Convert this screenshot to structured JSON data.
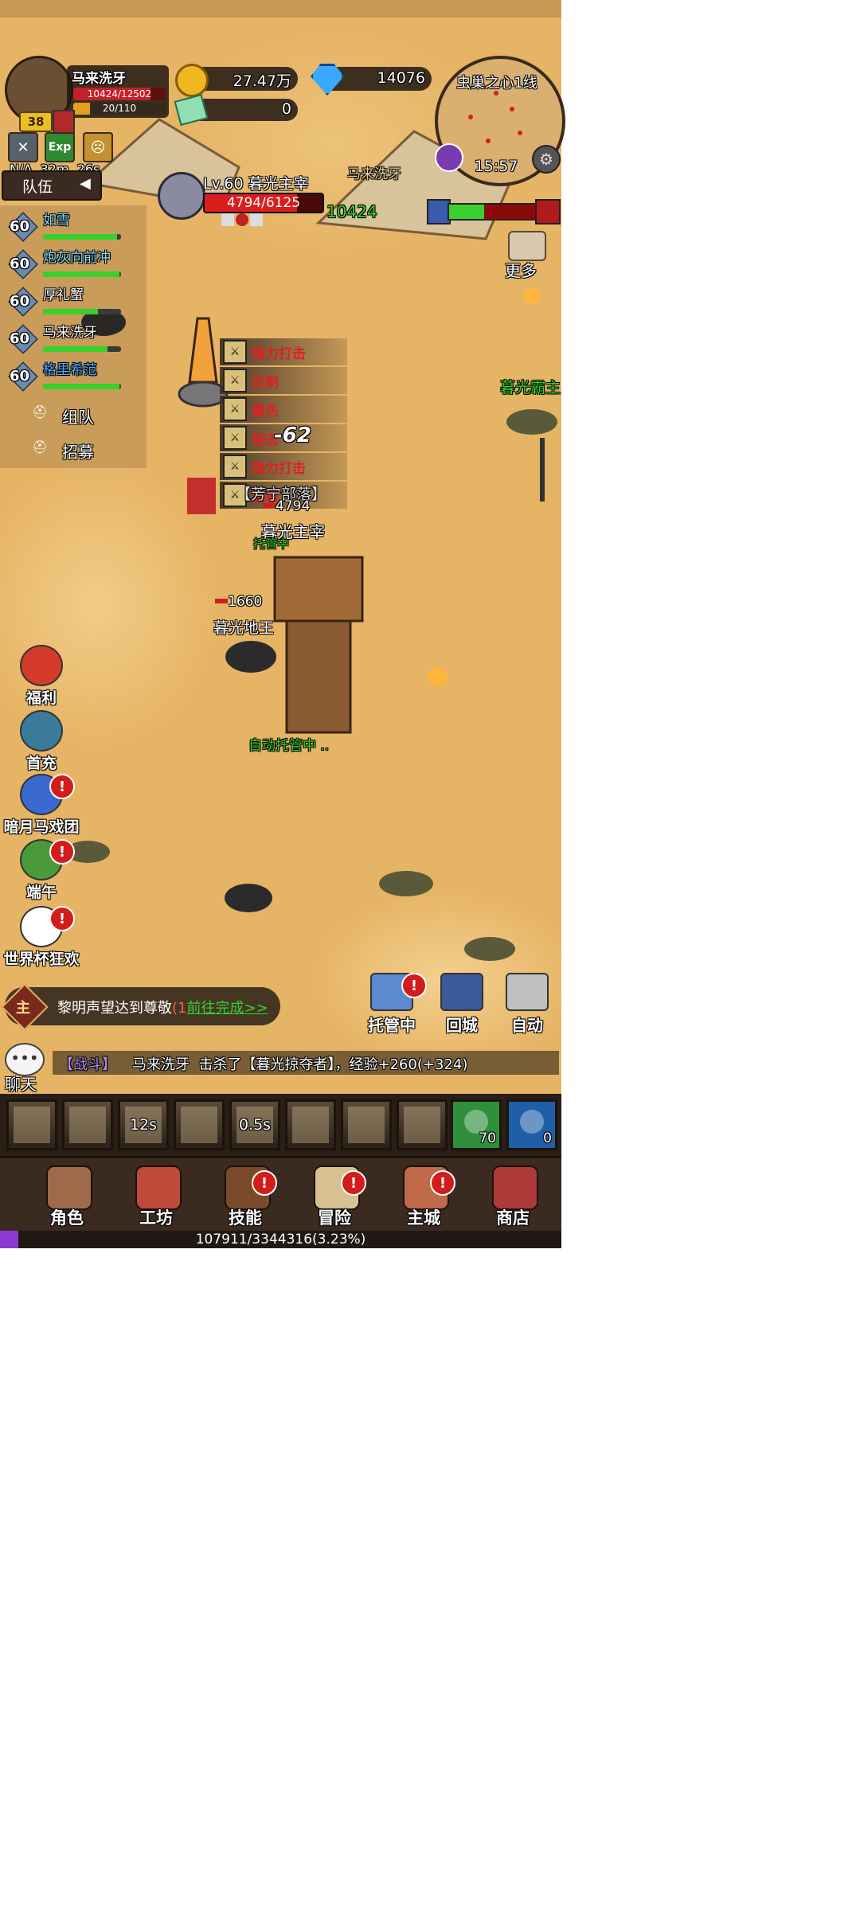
{
  "player": {
    "name": "马来洗牙",
    "hp_text": "10424/12502",
    "mp_text": "20/110",
    "level": "38",
    "buff_text": "N/A  32m  26s",
    "team_label": "队伍",
    "hp_ratio": 0.834,
    "mp_ratio": 0.18
  },
  "currency": {
    "gold": "27.47万",
    "gem": "14076",
    "ticket": "0"
  },
  "minimap": {
    "title": "虫巢之心1线",
    "time": "15:57"
  },
  "target": {
    "title": "Lv.60 暮光主宰",
    "hp_text": "4794/6125",
    "hp_ratio": 0.783
  },
  "world": {
    "player_label": "马来洗牙",
    "player_hp": "10424",
    "enemy_right": "暮光霸主",
    "guild_tag": "【芳宁部落】",
    "boss_hp_num": "4794",
    "boss_name": "暮光主宰",
    "managed_short": "托管中",
    "minion_hp": "1660",
    "minion_name": "暮光地王",
    "auto_managed": "自动托管中 ..",
    "damage": "-62"
  },
  "party": {
    "members": [
      {
        "level": "60",
        "name": "如雪",
        "color": "#8be0ff",
        "hp": 0.95
      },
      {
        "level": "60",
        "name": "炮灰向前冲",
        "color": "#8be0ff",
        "hp": 0.98
      },
      {
        "level": "60",
        "name": "厚礼蟹",
        "color": "#ffffff",
        "hp": 0.7
      },
      {
        "level": "60",
        "name": "马来洗牙",
        "color": "#ffffff",
        "hp": 0.83
      },
      {
        "level": "60",
        "name": "格里希范",
        "color": "#4aa8ff",
        "hp": 0.98
      }
    ],
    "team_btn": "组队",
    "recruit_btn": "招募"
  },
  "combat_log": [
    {
      "name": "强力打击"
    },
    {
      "name": "压制"
    },
    {
      "name": "重伤"
    },
    {
      "name": "挫志"
    },
    {
      "name": "强力打击"
    },
    {
      "name": "割裂"
    }
  ],
  "more_label": "更多",
  "left_menu": [
    {
      "label": "福利",
      "icon": "gift-icon",
      "alert": false
    },
    {
      "label": "首充",
      "icon": "first-charge-icon",
      "alert": false
    },
    {
      "label": "暗月马戏团",
      "icon": "circus-tent-icon",
      "alert": true
    },
    {
      "label": "端午",
      "icon": "rice-dumpling-icon",
      "alert": true
    },
    {
      "label": "世界杯狂欢",
      "icon": "soccer-ball-icon",
      "alert": true
    }
  ],
  "quest": {
    "tag": "主",
    "text": "黎明声望达到尊敬",
    "progress_mark": "(1",
    "link": "前往完成>>"
  },
  "actions": [
    {
      "label": "托管中",
      "icon": "monitor-icon",
      "alert": true
    },
    {
      "label": "回城",
      "icon": "portal-icon",
      "alert": false
    },
    {
      "label": "自动",
      "icon": "crossed-swords-icon",
      "alert": false
    }
  ],
  "chat": {
    "label": "聊天",
    "channel": "【战斗】",
    "message": "马来洗牙  击杀了【暮光掠夺者】，经验+260(+324)"
  },
  "skills": [
    {
      "cd": "",
      "icon": "slash-skill-icon"
    },
    {
      "cd": "",
      "icon": "shield-bash-skill-icon"
    },
    {
      "cd": "12s",
      "icon": "whirl-skill-icon"
    },
    {
      "cd": "",
      "icon": "claw-skill-icon"
    },
    {
      "cd": "0.5s",
      "icon": "strike-skill-icon"
    },
    {
      "cd": "",
      "icon": "roar-skill-icon"
    },
    {
      "cd": "",
      "icon": "berserk-skill-icon"
    },
    {
      "cd": "",
      "icon": "charge-skill-icon"
    }
  ],
  "consumables": [
    {
      "count": "70",
      "icon": "carrot-icon",
      "color": "#2f8f3a"
    },
    {
      "count": "0",
      "icon": "soup-bowl-icon",
      "color": "#1f5fa8"
    }
  ],
  "nav": [
    {
      "label": "角色",
      "icon": "character-icon",
      "alert": false
    },
    {
      "label": "工坊",
      "icon": "anvil-icon",
      "alert": false
    },
    {
      "label": "技能",
      "icon": "skill-book-icon",
      "alert": true
    },
    {
      "label": "冒险",
      "icon": "scroll-map-icon",
      "alert": true
    },
    {
      "label": "主城",
      "icon": "castle-icon",
      "alert": true
    },
    {
      "label": "商店",
      "icon": "shop-icon",
      "alert": false
    }
  ],
  "exp_text": "107911/3344316(3.23%)",
  "exp_ratio": 0.0323
}
